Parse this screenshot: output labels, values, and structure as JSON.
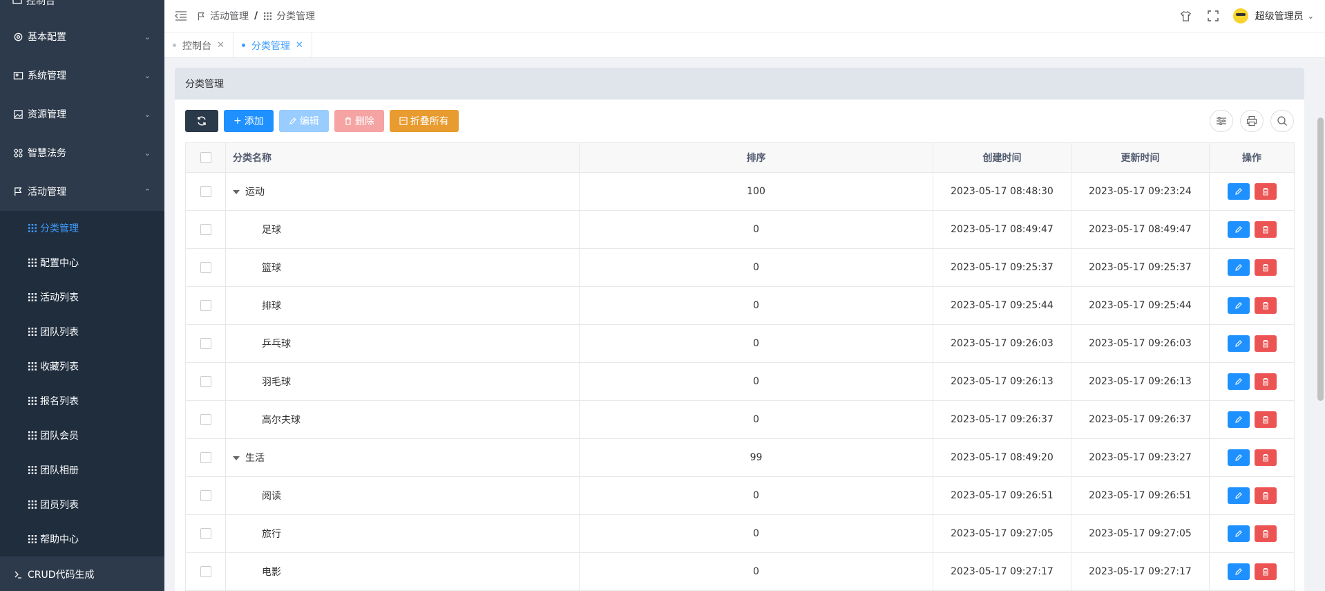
{
  "sidebar": {
    "partial_top": "控制台",
    "menus": [
      {
        "label": "基本配置",
        "icon": "gear-icon",
        "expanded": false
      },
      {
        "label": "系统管理",
        "icon": "user-manage-icon",
        "expanded": false
      },
      {
        "label": "资源管理",
        "icon": "image-icon",
        "expanded": false
      },
      {
        "label": "智慧法务",
        "icon": "grid-icon",
        "expanded": false
      },
      {
        "label": "活动管理",
        "icon": "flag-icon",
        "expanded": true
      }
    ],
    "sub_items": [
      "分类管理",
      "配置中心",
      "活动列表",
      "团队列表",
      "收藏列表",
      "报名列表",
      "团队会员",
      "团队相册",
      "团员列表",
      "帮助中心"
    ],
    "active_sub": "分类管理",
    "bottom": "CRUD代码生成"
  },
  "header": {
    "breadcrumb": [
      "活动管理",
      "分类管理"
    ],
    "user": "超级管理员"
  },
  "tabs": [
    {
      "label": "控制台",
      "active": false
    },
    {
      "label": "分类管理",
      "active": true
    }
  ],
  "panel": {
    "title": "分类管理",
    "buttons": {
      "add": "添加",
      "edit": "编辑",
      "delete": "删除",
      "fold": "折叠所有"
    }
  },
  "table": {
    "columns": [
      "分类名称",
      "排序",
      "创建时间",
      "更新时间",
      "操作"
    ],
    "rows": [
      {
        "name": "运动",
        "level": 0,
        "sort": "100",
        "created": "2023-05-17 08:48:30",
        "updated": "2023-05-17 09:23:24"
      },
      {
        "name": "足球",
        "level": 1,
        "sort": "0",
        "created": "2023-05-17 08:49:47",
        "updated": "2023-05-17 08:49:47"
      },
      {
        "name": "篮球",
        "level": 1,
        "sort": "0",
        "created": "2023-05-17 09:25:37",
        "updated": "2023-05-17 09:25:37"
      },
      {
        "name": "排球",
        "level": 1,
        "sort": "0",
        "created": "2023-05-17 09:25:44",
        "updated": "2023-05-17 09:25:44"
      },
      {
        "name": "乒乓球",
        "level": 1,
        "sort": "0",
        "created": "2023-05-17 09:26:03",
        "updated": "2023-05-17 09:26:03"
      },
      {
        "name": "羽毛球",
        "level": 1,
        "sort": "0",
        "created": "2023-05-17 09:26:13",
        "updated": "2023-05-17 09:26:13"
      },
      {
        "name": "高尔夫球",
        "level": 1,
        "sort": "0",
        "created": "2023-05-17 09:26:37",
        "updated": "2023-05-17 09:26:37"
      },
      {
        "name": "生活",
        "level": 0,
        "sort": "99",
        "created": "2023-05-17 08:49:20",
        "updated": "2023-05-17 09:23:27"
      },
      {
        "name": "阅读",
        "level": 1,
        "sort": "0",
        "created": "2023-05-17 09:26:51",
        "updated": "2023-05-17 09:26:51"
      },
      {
        "name": "旅行",
        "level": 1,
        "sort": "0",
        "created": "2023-05-17 09:27:05",
        "updated": "2023-05-17 09:27:05"
      },
      {
        "name": "电影",
        "level": 1,
        "sort": "0",
        "created": "2023-05-17 09:27:17",
        "updated": "2023-05-17 09:27:17"
      }
    ]
  },
  "colors": {
    "sidebar": "#2d3a4b",
    "submenu": "#1f2d3d",
    "primary": "#1e90ff",
    "danger": "#ec5454",
    "warning": "#e89b2f"
  }
}
